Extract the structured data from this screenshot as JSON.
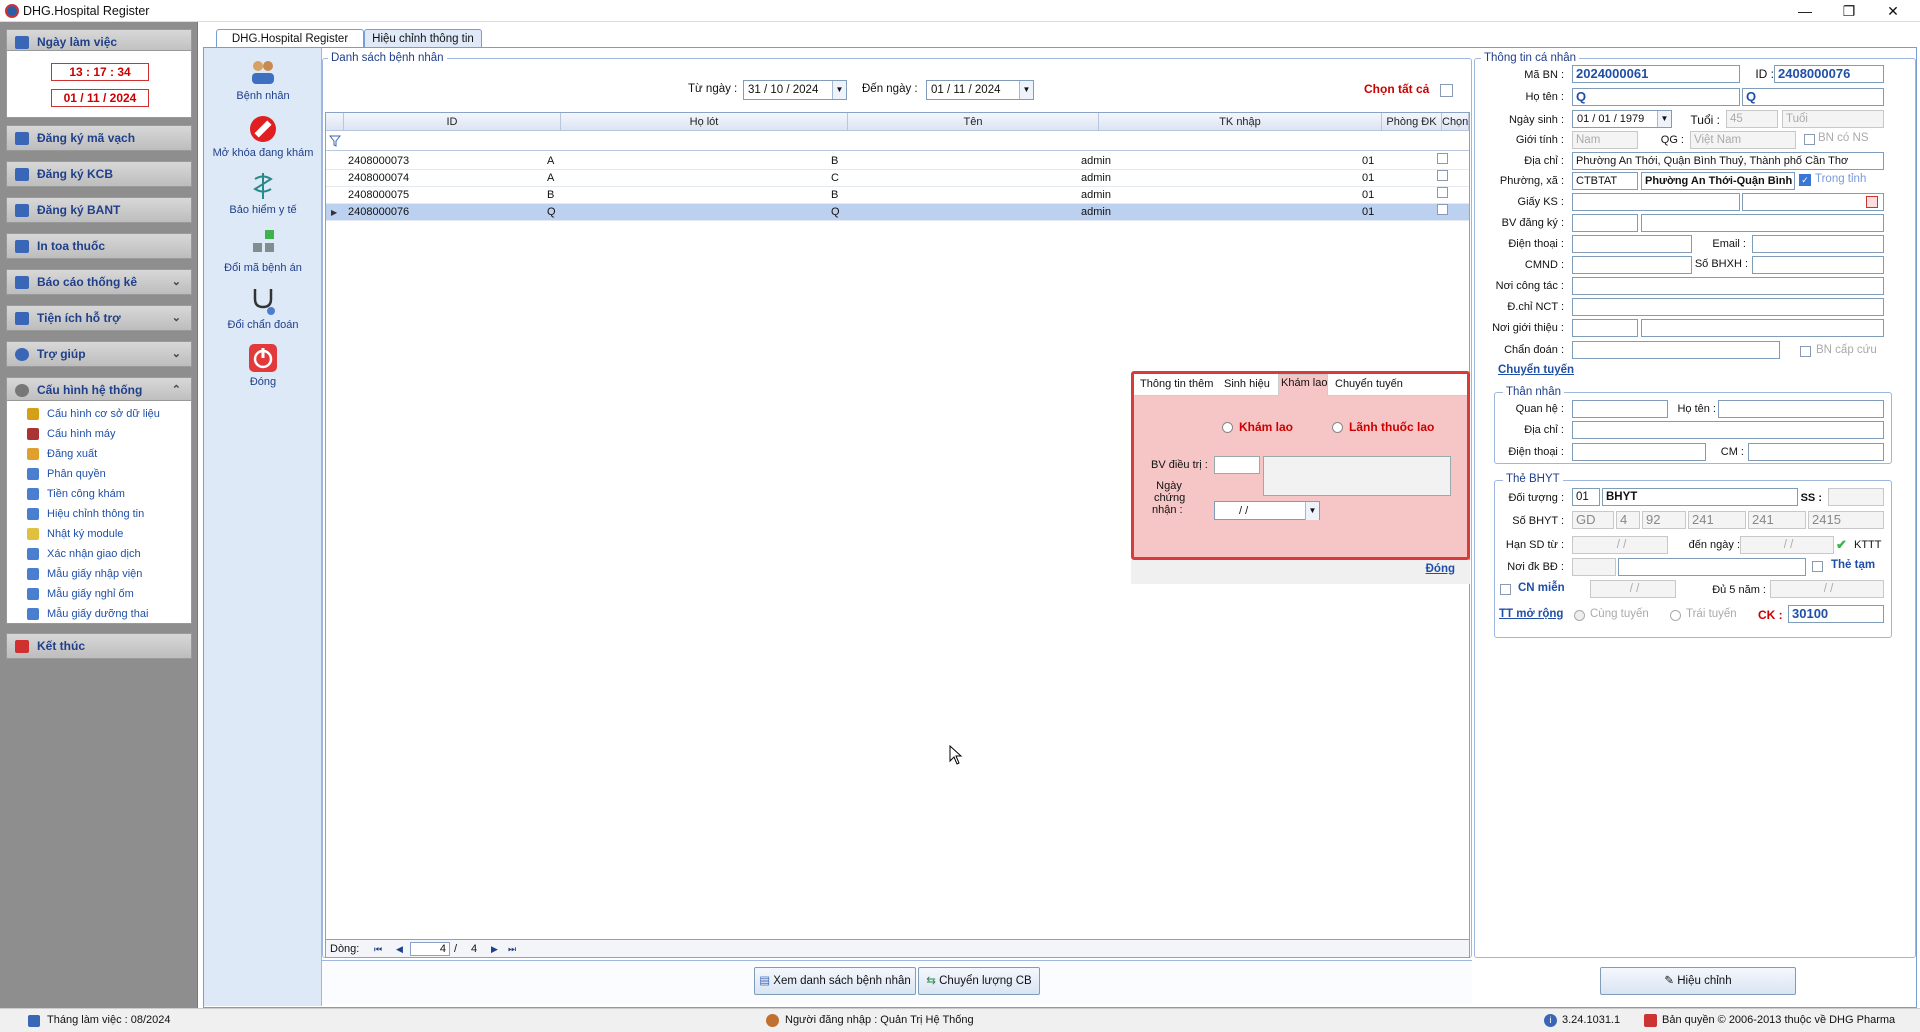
{
  "window": {
    "title": "DHG.Hospital Register",
    "minimize": "—",
    "restore": "❐",
    "close": "✕"
  },
  "nav": {
    "workday_header": "Ngày làm việc",
    "time": "13 : 17 : 34",
    "date": "01 / 11 / 2024",
    "items": [
      "Đăng ký mã vạch",
      "Đăng ký KCB",
      "Đăng ký BANT",
      "In toa thuốc",
      "Báo cáo thống kê",
      "Tiện ích hỗ trợ",
      "Trợ giúp",
      "Cấu hình hệ thống"
    ],
    "sub_items": [
      "Cấu hình cơ sở dữ liệu",
      "Cấu hình máy",
      "Đăng xuất",
      "Phân quyền",
      "Tiền công khám",
      "Hiệu chỉnh thông tin",
      "Nhật ký module",
      "Xác nhận giao dịch",
      "Mẫu giấy nhập viện",
      "Mẫu giấy nghỉ ốm",
      "Mẫu giấy dưỡng thai"
    ],
    "exit": "Kết thúc"
  },
  "tabs": [
    "DHG.Hospital Register",
    "Hiệu chỉnh thông tin"
  ],
  "toolbar": [
    "Bệnh nhân",
    "Mở khóa đang khám",
    "Bảo hiểm y tế",
    "Đổi mã bệnh án",
    "Đổi chẩn đoán",
    "Đóng"
  ],
  "list": {
    "group_title": "Danh sách bệnh nhân",
    "from_label": "Từ ngày :",
    "from_value": "31 / 10 / 2024",
    "to_label": "Đến  ngày :",
    "to_value": "01 / 11 / 2024",
    "select_all": "Chọn tất cả",
    "columns": [
      "ID",
      "Họ lót",
      "Tên",
      "TK nhập",
      "Phòng ĐK",
      "Chọn"
    ],
    "rows": [
      {
        "id": "2408000073",
        "ho_lot": "A",
        "ten": "B",
        "tk": "admin",
        "phong": "01"
      },
      {
        "id": "2408000074",
        "ho_lot": "A",
        "ten": "C",
        "tk": "admin",
        "phong": "01"
      },
      {
        "id": "2408000075",
        "ho_lot": "B",
        "ten": "B",
        "tk": "admin",
        "phong": "01"
      },
      {
        "id": "2408000076",
        "ho_lot": "Q",
        "ten": "Q",
        "tk": "admin",
        "phong": "01"
      }
    ],
    "footer_label": "Dòng:",
    "page_current": "4",
    "page_sep": "/",
    "page_total": "4"
  },
  "bottom": {
    "view_list": "Xem danh sách bệnh nhân",
    "transfer": "Chuyển lượng CB",
    "edit": "Hiệu chỉnh"
  },
  "popup": {
    "tabs": [
      "Thông tin thêm",
      "Sinh hiệu",
      "Khám lao",
      "Chuyển tuyến"
    ],
    "radio1": "Khám lao",
    "radio2": "Lãnh thuốc lao",
    "bv_label": "BV điều trị :",
    "cert_label1": "Ngày",
    "cert_label2": "chứng",
    "cert_label3": "nhận :",
    "date_value": "/    /",
    "close": "Đóng"
  },
  "patient": {
    "group_title": "Thông tin cá nhân",
    "ma_bn_label": "Mã BN :",
    "ma_bn": "2024000061",
    "id_label": "ID :",
    "id": "2408000076",
    "ho_ten_label": "Họ tên :",
    "ho_ten": "Q",
    "ten": "Q",
    "ngay_sinh_label": "Ngày sinh :",
    "ngay_sinh": "01 / 01 / 1979",
    "tuoi_label": "Tuổi :",
    "tuoi": "45",
    "tuoi_unit": "Tuổi",
    "gioi_tinh_label": "Giới tính :",
    "gioi_tinh": "Nam",
    "qg_label": "QG :",
    "qg": "Việt Nam",
    "bn_co_ns": "BN có NS",
    "dia_chi_label": "Địa chỉ :",
    "dia_chi": "Phường An Thới, Quận Bình Thuỷ, Thành phố Cần Thơ",
    "phuong_label": "Phường, xã :",
    "phuong_code": "CTBTAT",
    "phuong": "Phường An Thới-Quận Bình",
    "trong_tinh": "Trong tỉnh",
    "giay_ks_label": "Giấy KS :",
    "bv_dk_label": "BV đăng ký :",
    "dien_thoai_label": "Điện thoại :",
    "email_label": "Email :",
    "cmnd_label": "CMND :",
    "so_bhxh_label": "Số BHXH :",
    "noi_cong_tac_label": "Nơi công tác :",
    "dchi_nct_label": "Đ.chỉ NCT :",
    "noi_gioi_thieu_label": "Nơi giới thiệu :",
    "chan_doan_label": "Chẩn đoán :",
    "bn_cap_cuu": "BN cấp cứu",
    "chuyen_tuyen": "Chuyển tuyến"
  },
  "relative": {
    "group_title": "Thân nhân",
    "quan_he_label": "Quan hệ :",
    "ho_ten_label": "Họ tên :",
    "dia_chi_label": "Địa chỉ :",
    "dien_thoai_label": "Điện thoại :",
    "cm_label": "CM :"
  },
  "bhyt": {
    "group_title": "Thẻ BHYT",
    "doi_tuong_label": "Đối tượng :",
    "doi_tuong_code": "01",
    "doi_tuong": "BHYT",
    "ss_label": "SS :",
    "so_bhyt_label": "Số BHYT :",
    "so_bhyt_parts": [
      "GD",
      "4",
      "92",
      "241",
      "241",
      "2415"
    ],
    "han_sd_label": "Hạn SD từ :",
    "den_ngay_label": "đến  ngày :",
    "date_blank": "/    /",
    "kttt": "KTTT",
    "noi_dk_label": "Nơi đk BĐ :",
    "the_tam": "Thẻ tạm",
    "cn_mien": "CN miễn",
    "du5nam_label": "Đủ 5 năm :",
    "tt_mo_rong": "TT mở rộng",
    "cung_tuyen": "Cùng tuyến",
    "trai_tuyen": "Trái tuyến",
    "ck_label": "CK :",
    "ck_value": "30100"
  },
  "status": {
    "month": "Tháng làm việc : 08/2024",
    "user": "Người đăng nhập : Quản Trị Hệ Thống",
    "version": "3.24.1031.1",
    "copyright": "Bản quyền © 2006-2013 thuộc về DHG Pharma"
  }
}
